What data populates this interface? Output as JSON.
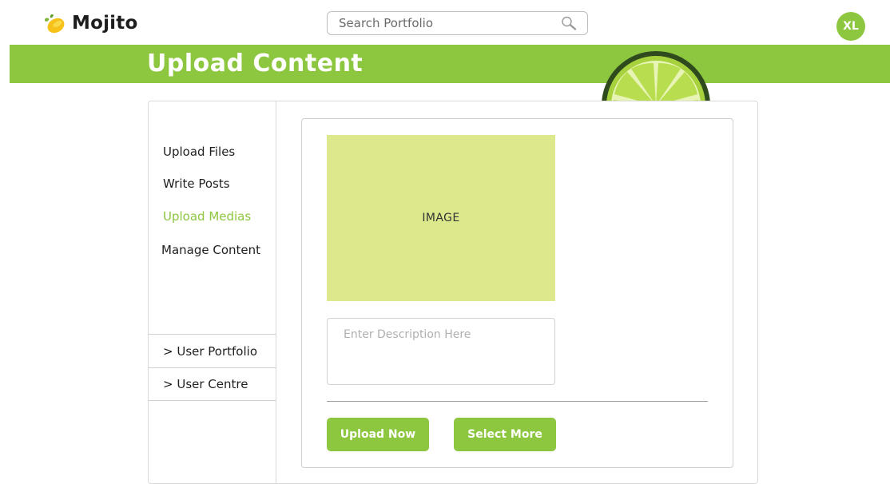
{
  "app": {
    "name": "Mojito",
    "logo_icon": "lemon-icon"
  },
  "search": {
    "placeholder": "Search Portfolio",
    "icon": "magnifier-icon"
  },
  "user": {
    "initials": "XL",
    "avatar_color": "#8dc63f"
  },
  "page": {
    "title": "Upload Content",
    "banner_icon": "lime-slice-icon"
  },
  "sidebar": {
    "items": [
      {
        "label": "Upload Files",
        "active": false
      },
      {
        "label": "Write Posts",
        "active": false
      },
      {
        "label": "Upload Medias",
        "active": true
      },
      {
        "label": "Manage Content",
        "active": false
      }
    ],
    "links": [
      {
        "label": "> User Portfolio"
      },
      {
        "label": "> User Centre"
      }
    ]
  },
  "upload": {
    "image_placeholder": "IMAGE",
    "description_placeholder": "Enter Description Here",
    "upload_button": "Upload Now",
    "select_button": "Select More"
  },
  "colors": {
    "accent": "#8dc63f",
    "image_placeholder_bg": "#dde88d",
    "text": "#1f1f1f"
  }
}
